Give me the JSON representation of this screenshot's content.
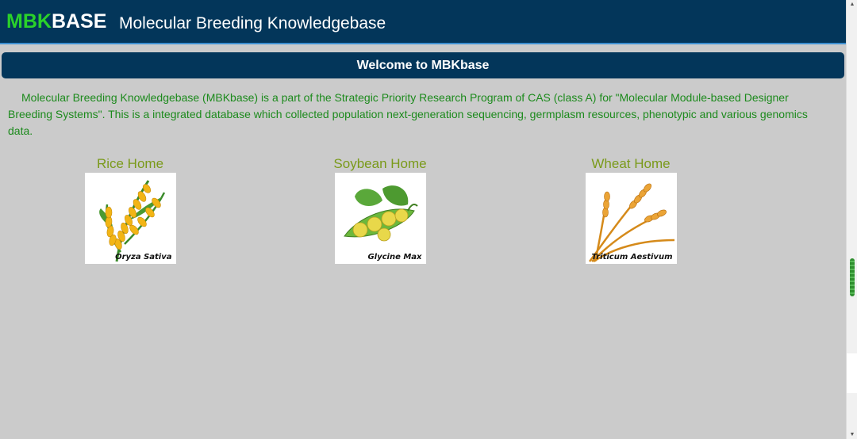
{
  "header": {
    "logo_mbk": "MBK",
    "logo_base": "BASE",
    "title": "Molecular Breeding Knowledgebase"
  },
  "welcome": {
    "title": "Welcome to MBKbase"
  },
  "intro": {
    "text": "Molecular Breeding Knowledgebase (MBKbase) is a part of the Strategic Priority Research Program of CAS (class A) for \"Molecular Module-based Designer Breeding Systems\". This is a integrated database which collected population next-generation sequencing, germplasm resources, phenotypic and various genomics data."
  },
  "crops": [
    {
      "label": "Rice Home",
      "latin": "Oryza Sativa",
      "icon": "rice-icon"
    },
    {
      "label": "Soybean Home",
      "latin": "Glycine Max",
      "icon": "soybean-icon"
    },
    {
      "label": "Wheat Home",
      "latin": "Triticum Aestivum",
      "icon": "wheat-icon"
    }
  ],
  "colors": {
    "header_bg": "#03365a",
    "logo_accent": "#2ad12a",
    "intro_text": "#1c8a1c",
    "crop_link": "#7a9a1a",
    "page_bg": "#cbcbcb"
  }
}
